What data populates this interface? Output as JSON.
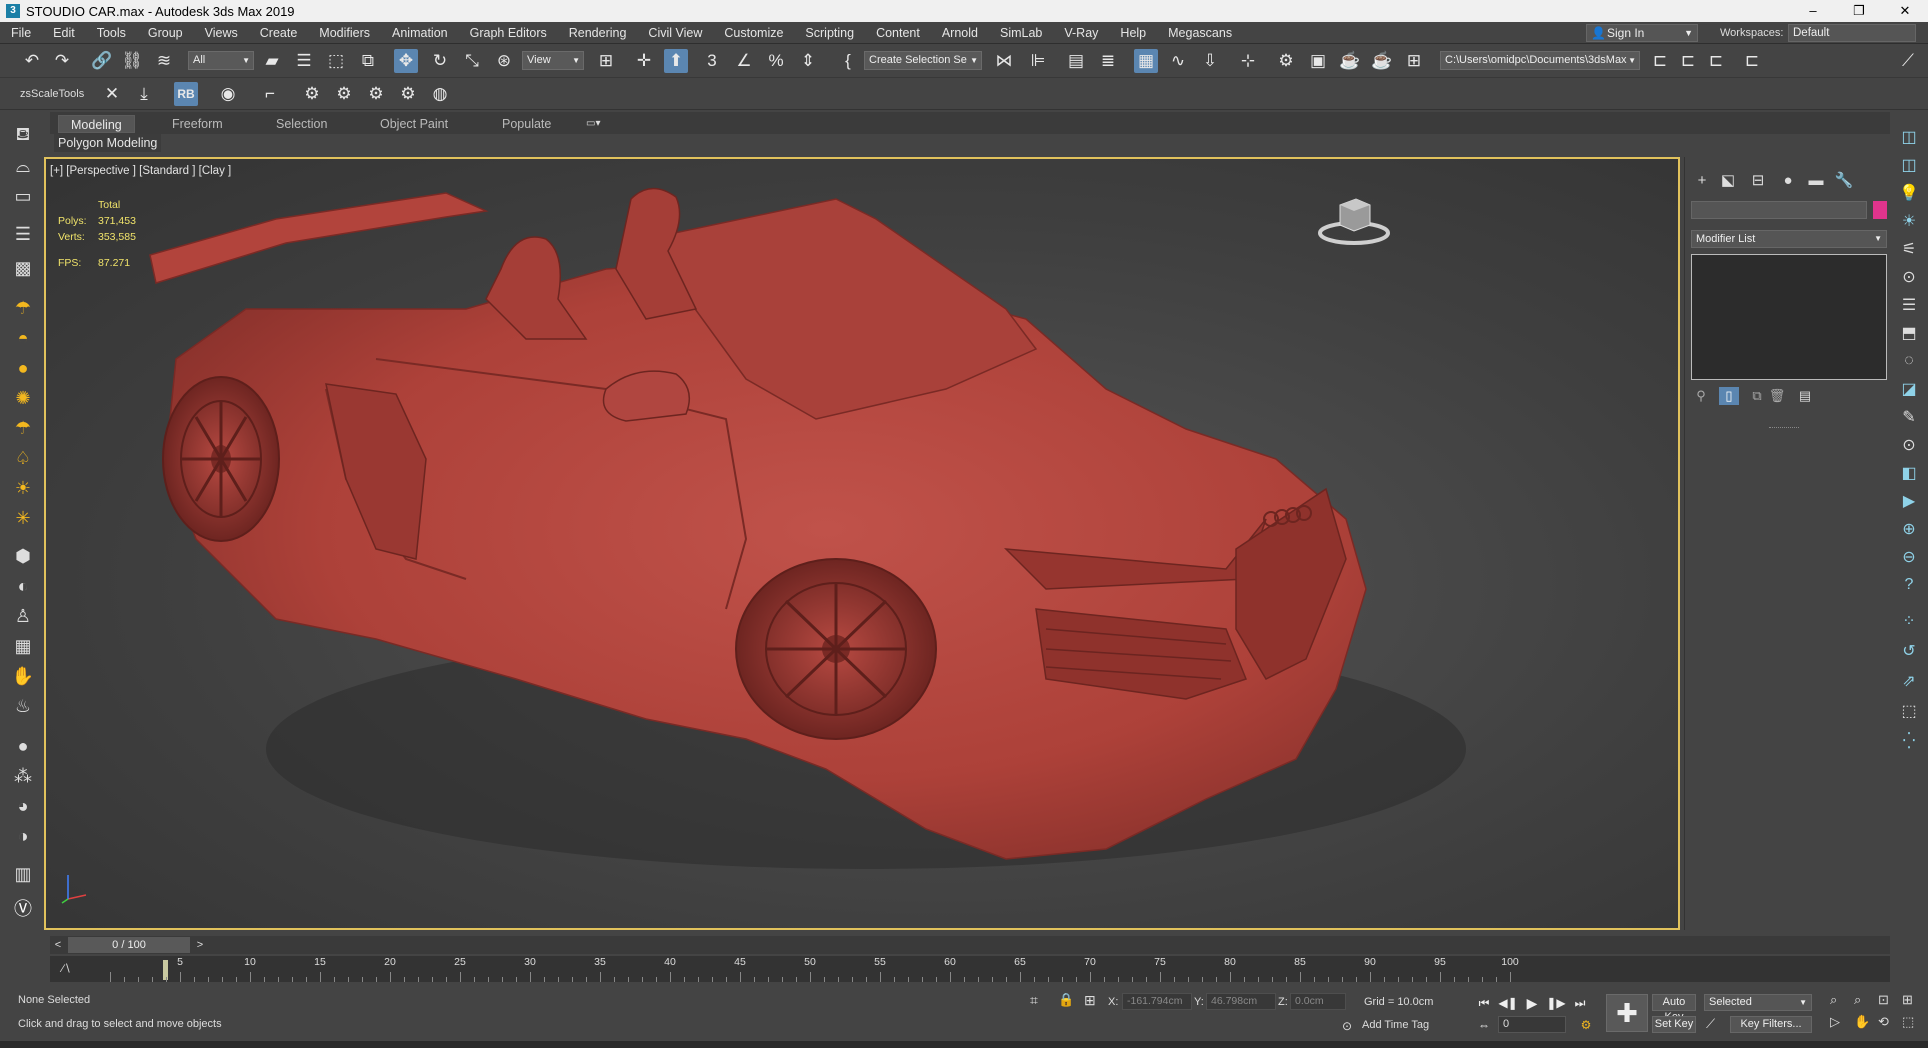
{
  "window": {
    "title": "STOUDIO  CAR.max - Autodesk 3ds Max 2019",
    "app_icon": "3",
    "min": "–",
    "restore": "❐",
    "close": "✕"
  },
  "menu": [
    "File",
    "Edit",
    "Tools",
    "Group",
    "Views",
    "Create",
    "Modifiers",
    "Animation",
    "Graph Editors",
    "Rendering",
    "Civil View",
    "Customize",
    "Scripting",
    "Content",
    "Arnold",
    "SimLab",
    "V-Ray",
    "Help",
    "Megascans"
  ],
  "account": {
    "signin_label": "Sign In",
    "workspaces_label": "Workspaces:",
    "workspace_value": "Default"
  },
  "toolbar": {
    "selection_filter": "All",
    "ref_coord": "View",
    "named_selection": "Create Selection Se",
    "project_path": "C:\\Users\\omidpc\\Documents\\3dsMax",
    "zs_label": "zsScaleTools"
  },
  "ribbon": {
    "tabs": [
      "Modeling",
      "Freeform",
      "Selection",
      "Object Paint",
      "Populate"
    ],
    "active_tab": "Modeling",
    "panel_label": "Polygon Modeling"
  },
  "viewport": {
    "label": "[+] [Perspective ] [Standard ] [Clay ]",
    "stats": {
      "total_label": "Total",
      "polys_label": "Polys:",
      "polys": "371,453",
      "verts_label": "Verts:",
      "verts": "353,585",
      "fps_label": "FPS:",
      "fps": "87.271"
    },
    "model_color": "#b5463f",
    "border_color": "#e1c25c"
  },
  "command_panel": {
    "modifier_list": "Modifier List",
    "object_color": "#e0348c"
  },
  "timeline": {
    "frame_display": "0 / 100",
    "prev": "<",
    "next": ">",
    "ticks": [
      "5",
      "10",
      "15",
      "20",
      "25",
      "30",
      "35",
      "40",
      "45",
      "50",
      "55",
      "60",
      "65",
      "70",
      "75",
      "80",
      "85",
      "90",
      "95",
      "100"
    ]
  },
  "status": {
    "selection": "None Selected",
    "prompt": "Click and drag to select and move objects",
    "x_label": "X:",
    "x_value": "-161.794cm",
    "y_label": "Y:",
    "y_value": "46.798cm",
    "z_label": "Z:",
    "z_value": "0.0cm",
    "grid": "Grid = 10.0cm",
    "add_time_tag": "Add Time Tag",
    "auto_key": "Auto Key",
    "set_key": "Set Key",
    "key_mode": "Selected",
    "key_filters": "Key Filters...",
    "current_frame": "0"
  }
}
